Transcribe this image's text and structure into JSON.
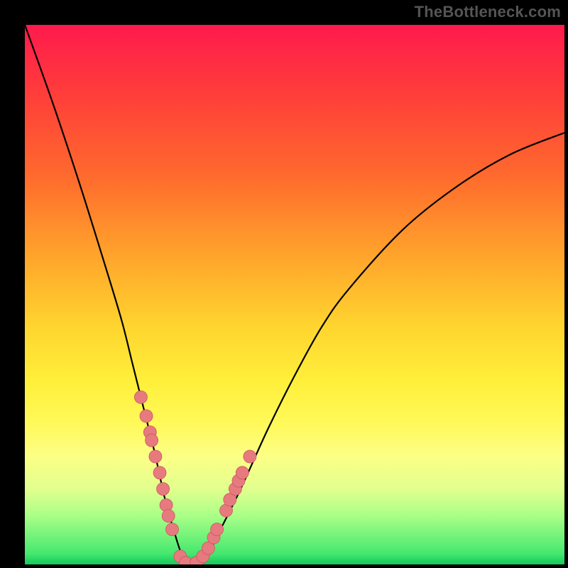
{
  "watermark": "TheBottleneck.com",
  "chart_data": {
    "type": "line",
    "title": "",
    "xlabel": "",
    "ylabel": "",
    "xlim": [
      0,
      100
    ],
    "ylim": [
      0,
      100
    ],
    "series": [
      {
        "name": "bottleneck-curve",
        "x": [
          0,
          5,
          10,
          15,
          18,
          20,
          22,
          24,
          26,
          28,
          29,
          30,
          31,
          32,
          34,
          36,
          40,
          45,
          50,
          55,
          60,
          70,
          80,
          90,
          100
        ],
        "y": [
          100,
          86,
          71,
          55,
          45,
          37,
          29,
          21,
          12,
          5,
          2,
          0,
          0,
          0,
          2,
          6,
          14,
          25,
          35,
          44,
          51,
          62,
          70,
          76,
          80
        ]
      }
    ],
    "markers": {
      "name": "sample-points",
      "x": [
        21.5,
        22.5,
        23.2,
        23.5,
        24.2,
        25.0,
        25.6,
        26.2,
        26.6,
        27.3,
        28.8,
        29.8,
        31.8,
        33.0,
        34.0,
        35.0,
        35.6,
        37.3,
        38.0,
        39.0,
        39.6,
        40.3,
        41.7
      ],
      "y": [
        31.0,
        27.5,
        24.5,
        23.0,
        20.0,
        17.0,
        14.0,
        11.0,
        9.0,
        6.5,
        1.5,
        0.3,
        0.3,
        1.5,
        3.0,
        5.0,
        6.5,
        10.0,
        12.0,
        14.0,
        15.5,
        17.0,
        20.0
      ]
    },
    "background_gradient": {
      "top": "#ff1a4d",
      "mid": "#ffd52f",
      "bottom": "#12c95d"
    }
  }
}
